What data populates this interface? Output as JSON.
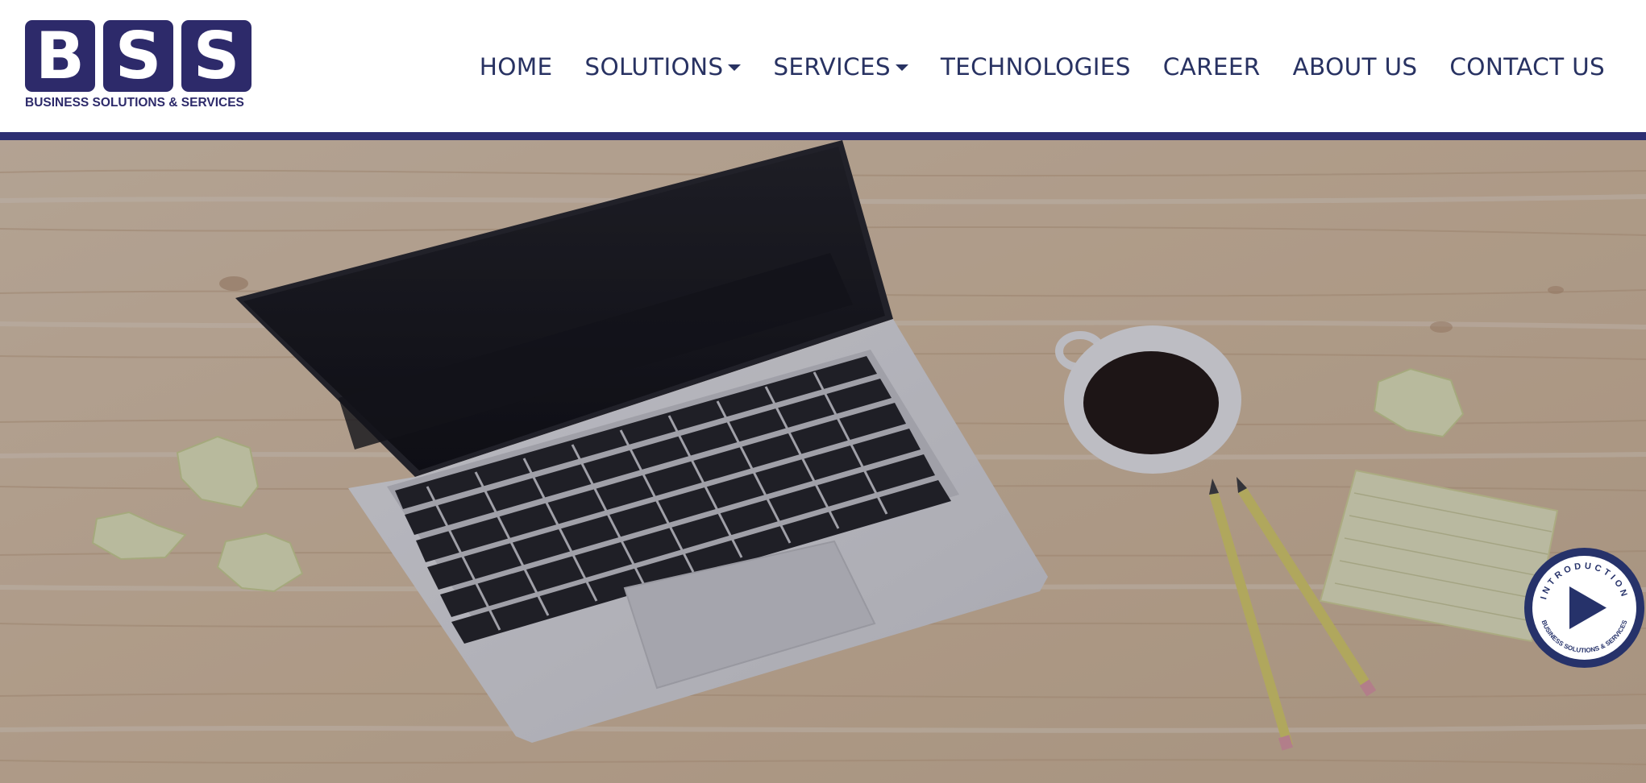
{
  "brand": {
    "letters": [
      "B",
      "S",
      "S"
    ],
    "tagline": "BUSINESS SOLUTIONS & SERVICES",
    "color": "#2d2a6a"
  },
  "nav": {
    "items": [
      {
        "label": "HOME",
        "dropdown": false
      },
      {
        "label": "SOLUTIONS",
        "dropdown": true
      },
      {
        "label": "SERVICES",
        "dropdown": true
      },
      {
        "label": "TECHNOLOGIES",
        "dropdown": false
      },
      {
        "label": "CAREER",
        "dropdown": false
      },
      {
        "label": "ABOUT US",
        "dropdown": false
      },
      {
        "label": "CONTACT US",
        "dropdown": false
      }
    ],
    "text_color": "#283262"
  },
  "accent_bar_color": "#2d2f72",
  "intro_badge": {
    "top_text": "INTRODUCTION",
    "bottom_text": "BUSINESS SOLUTIONS & SERVICES",
    "icon": "play-icon"
  }
}
